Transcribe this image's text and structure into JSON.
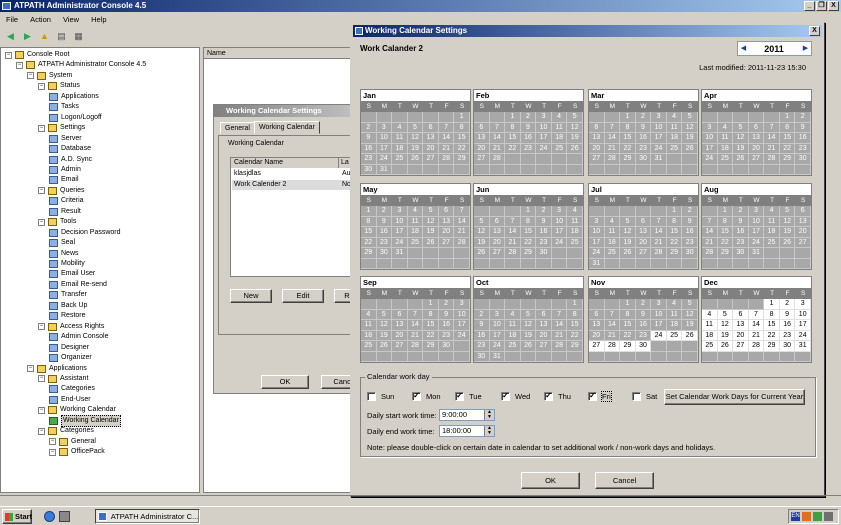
{
  "app": {
    "title": "ATPATH Administrator Console 4.5"
  },
  "window_controls": {
    "minimize": "_",
    "restore": "❐",
    "close": "X"
  },
  "menu": [
    "File",
    "Action",
    "View",
    "Help"
  ],
  "tree": {
    "nodes": [
      {
        "label": "Console Root",
        "depth": 0,
        "type": "root"
      },
      {
        "label": "ATPATH Administrator Console 4.5",
        "depth": 1,
        "type": "folder"
      },
      {
        "label": "System",
        "depth": 2,
        "type": "folder"
      },
      {
        "label": "Status",
        "depth": 3,
        "type": "folder"
      },
      {
        "label": "Applications",
        "depth": 4,
        "type": "leaf"
      },
      {
        "label": "Tasks",
        "depth": 4,
        "type": "leaf"
      },
      {
        "label": "Logon/Logoff",
        "depth": 4,
        "type": "leaf"
      },
      {
        "label": "Settings",
        "depth": 3,
        "type": "folder"
      },
      {
        "label": "Server",
        "depth": 4,
        "type": "leaf"
      },
      {
        "label": "Database",
        "depth": 4,
        "type": "leaf"
      },
      {
        "label": "A.D. Sync",
        "depth": 4,
        "type": "leaf"
      },
      {
        "label": "Admin",
        "depth": 4,
        "type": "leaf"
      },
      {
        "label": "Email",
        "depth": 4,
        "type": "leaf"
      },
      {
        "label": "Queries",
        "depth": 3,
        "type": "folder"
      },
      {
        "label": "Criteria",
        "depth": 4,
        "type": "leaf"
      },
      {
        "label": "Result",
        "depth": 4,
        "type": "leaf"
      },
      {
        "label": "Tools",
        "depth": 3,
        "type": "folder"
      },
      {
        "label": "Decision Password",
        "depth": 4,
        "type": "leaf"
      },
      {
        "label": "Seal",
        "depth": 4,
        "type": "leaf"
      },
      {
        "label": "News",
        "depth": 4,
        "type": "leaf"
      },
      {
        "label": "Mobility",
        "depth": 4,
        "type": "leaf"
      },
      {
        "label": "Email User",
        "depth": 4,
        "type": "leaf"
      },
      {
        "label": "Email Re-send",
        "depth": 4,
        "type": "leaf"
      },
      {
        "label": "Transfer",
        "depth": 4,
        "type": "leaf"
      },
      {
        "label": "Back Up",
        "depth": 4,
        "type": "leaf"
      },
      {
        "label": "Restore",
        "depth": 4,
        "type": "leaf"
      },
      {
        "label": "Access Rights",
        "depth": 3,
        "type": "folder"
      },
      {
        "label": "Admin Console",
        "depth": 4,
        "type": "leaf"
      },
      {
        "label": "Designer",
        "depth": 4,
        "type": "leaf"
      },
      {
        "label": "Organizer",
        "depth": 4,
        "type": "leaf"
      },
      {
        "label": "Applications",
        "depth": 2,
        "type": "folder"
      },
      {
        "label": "Assistant",
        "depth": 3,
        "type": "folder"
      },
      {
        "label": "Categories",
        "depth": 4,
        "type": "leaf"
      },
      {
        "label": "End-User",
        "depth": 4,
        "type": "leaf"
      },
      {
        "label": "Working Calendar",
        "depth": 3,
        "type": "folder"
      },
      {
        "label": "Working Calendar",
        "depth": 4,
        "type": "selected"
      },
      {
        "label": "Categories",
        "depth": 3,
        "type": "folder"
      },
      {
        "label": "General",
        "depth": 4,
        "type": "folder"
      },
      {
        "label": "OfficePack",
        "depth": 4,
        "type": "folder"
      }
    ]
  },
  "list": {
    "column_name": "Name"
  },
  "bg_dialog": {
    "title": "Working Calendar Settings",
    "tabs": [
      "General",
      "Working Calendar"
    ],
    "group": "Working Calendar",
    "columns": [
      "Calendar Name",
      "La"
    ],
    "rows": [
      [
        "klasjdlas",
        "Au"
      ],
      [
        "Work Calender 2",
        "No"
      ]
    ],
    "buttons": {
      "new": "New",
      "edit": "Edit",
      "third": "Re",
      "ok": "OK",
      "cancel": "Cancel"
    }
  },
  "dialog": {
    "title": "Working Calendar Settings",
    "calendar_name": "Work Calander 2",
    "year": "2011",
    "last_modified": "Last modified: 2011-11-23 15:30",
    "weekday_headers": [
      "S",
      "M",
      "T",
      "W",
      "T",
      "F",
      "S"
    ],
    "months": [
      {
        "name": "Jan",
        "first_weekday": 6,
        "days": 31
      },
      {
        "name": "Feb",
        "first_weekday": 2,
        "days": 28
      },
      {
        "name": "Mar",
        "first_weekday": 2,
        "days": 31
      },
      {
        "name": "Apr",
        "first_weekday": 5,
        "days": 30
      },
      {
        "name": "May",
        "first_weekday": 0,
        "days": 31
      },
      {
        "name": "Jun",
        "first_weekday": 3,
        "days": 30
      },
      {
        "name": "Jul",
        "first_weekday": 5,
        "days": 31
      },
      {
        "name": "Aug",
        "first_weekday": 1,
        "days": 31
      },
      {
        "name": "Sep",
        "first_weekday": 4,
        "days": 30
      },
      {
        "name": "Oct",
        "first_weekday": 6,
        "days": 31
      },
      {
        "name": "Nov",
        "first_weekday": 2,
        "days": 30,
        "active_from": 24
      },
      {
        "name": "Dec",
        "first_weekday": 4,
        "days": 31,
        "active_from": 1
      }
    ],
    "workday_group": "Calendar work day",
    "days": [
      {
        "label": "Sun",
        "checked": false
      },
      {
        "label": "Mon",
        "checked": true
      },
      {
        "label": "Tue",
        "checked": true
      },
      {
        "label": "Wed",
        "checked": true
      },
      {
        "label": "Thu",
        "checked": true
      },
      {
        "label": "Fri",
        "checked": true
      },
      {
        "label": "Sat",
        "checked": false
      }
    ],
    "set_button": "Set Calendar Work Days for Current Year",
    "start_label": "Daily start work time:",
    "start_value": "9:00:00",
    "end_label": "Daily end work time:",
    "end_value": "18:00:00",
    "note": "Note: please double-click on certain date in calendar to set additional work / non-work days and holidays.",
    "ok": "OK",
    "cancel": "Cancel"
  },
  "taskbar": {
    "start": "Start",
    "task": "ATPATH Administrator C...",
    "tray_lang": "EN"
  }
}
